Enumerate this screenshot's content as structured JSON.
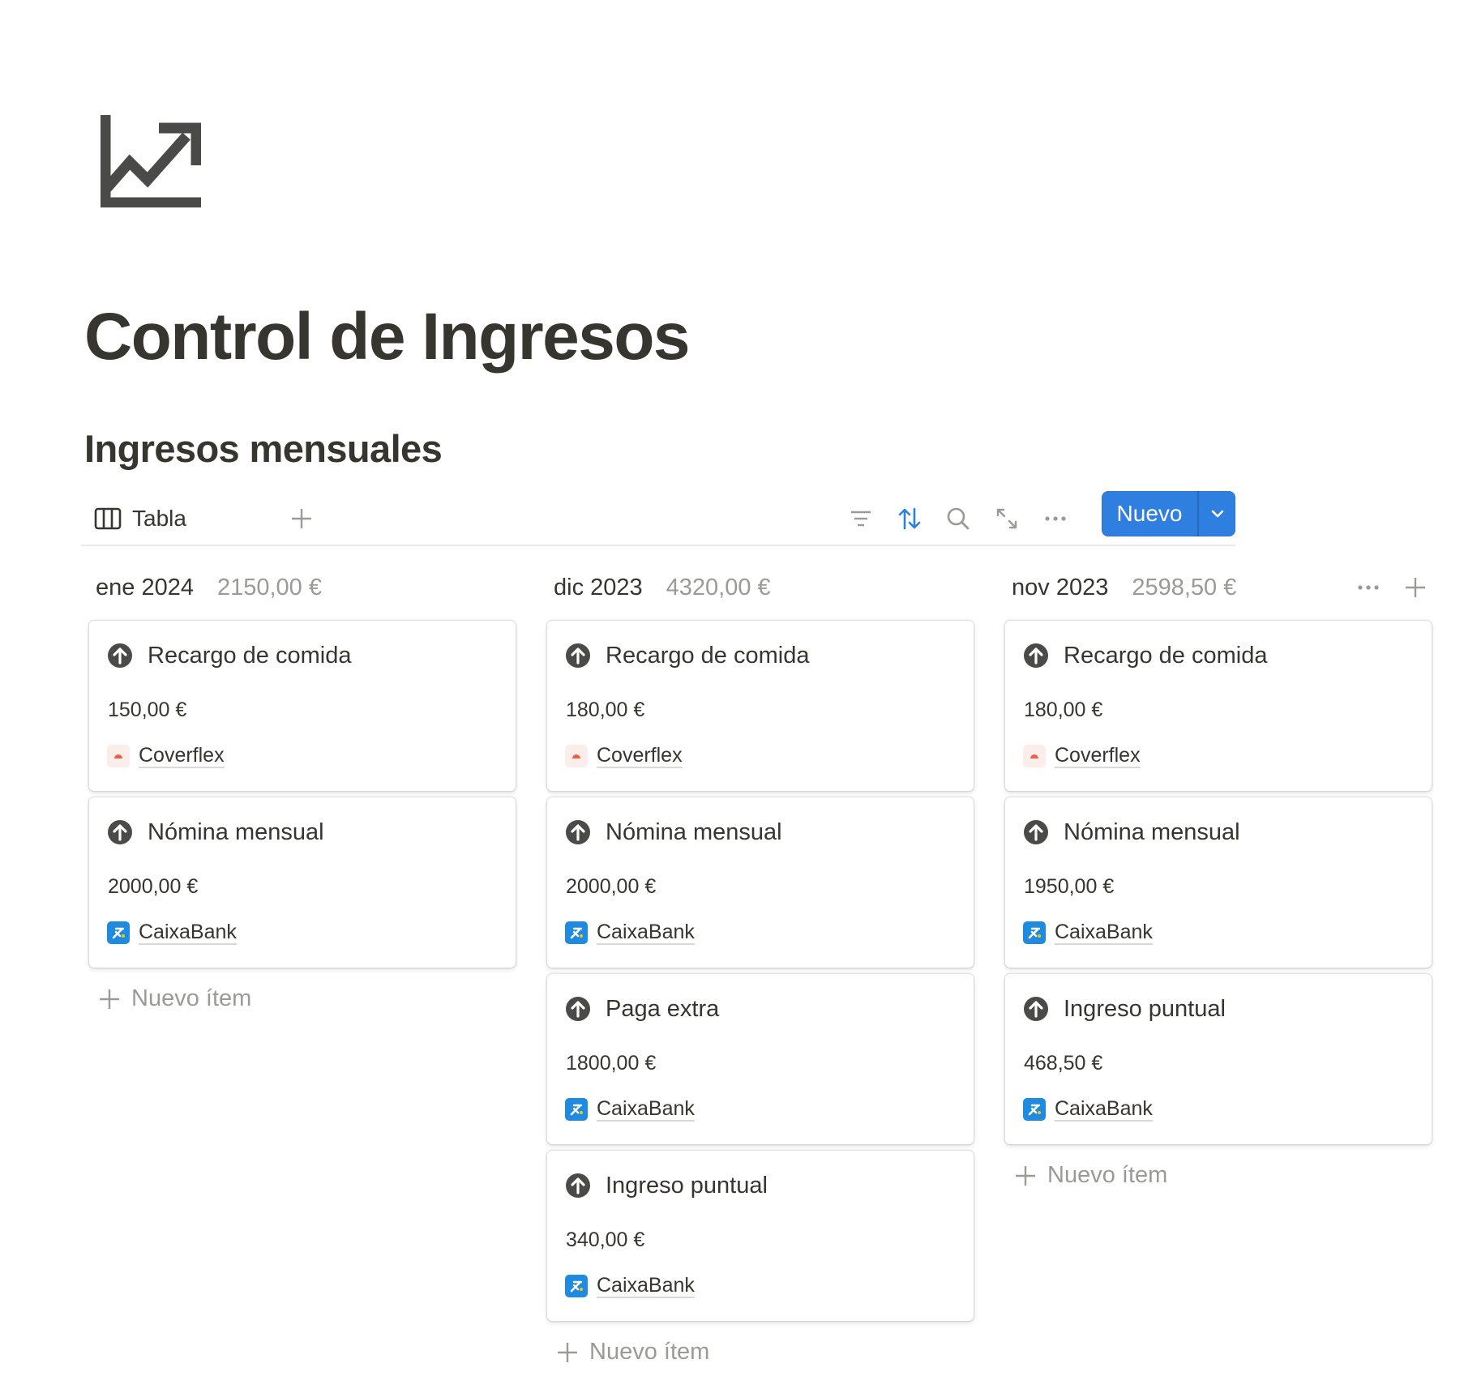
{
  "page": {
    "icon": "trending-up-chart-icon",
    "title": "Control de Ingresos"
  },
  "database": {
    "title": "Ingresos mensuales",
    "view_tab": {
      "label": "Tabla",
      "icon": "board-view-icon"
    },
    "toolbar": {
      "add_view_icon": "plus-icon",
      "filter_icon": "filter-icon",
      "sort_icon": "sort-icon",
      "search_icon": "search-icon",
      "expand_icon": "expand-icon",
      "more_icon": "more-horizontal-icon",
      "new_button_label": "Nuevo",
      "new_button_caret_icon": "chevron-down-icon"
    },
    "accent_color": "#2f7fe0",
    "columns": [
      {
        "title": "ene 2024",
        "sum": "2150,00 €",
        "new_item_label": "Nuevo ítem",
        "cards": [
          {
            "title": "Recargo de comida",
            "amount": "150,00 €",
            "relation": "Coverflex"
          },
          {
            "title": "Nómina mensual",
            "amount": "2000,00 €",
            "relation": "CaixaBank"
          }
        ]
      },
      {
        "title": "dic 2023",
        "sum": "4320,00 €",
        "new_item_label": "Nuevo ítem",
        "cards": [
          {
            "title": "Recargo de comida",
            "amount": "180,00 €",
            "relation": "Coverflex"
          },
          {
            "title": "Nómina mensual",
            "amount": "2000,00 €",
            "relation": "CaixaBank"
          },
          {
            "title": "Paga extra",
            "amount": "1800,00 €",
            "relation": "CaixaBank"
          },
          {
            "title": "Ingreso puntual",
            "amount": "340,00 €",
            "relation": "CaixaBank"
          }
        ]
      },
      {
        "title": "nov 2023",
        "sum": "2598,50 €",
        "new_item_label": "Nuevo ítem",
        "cards": [
          {
            "title": "Recargo de comida",
            "amount": "180,00 €",
            "relation": "Coverflex"
          },
          {
            "title": "Nómina mensual",
            "amount": "1950,00 €",
            "relation": "CaixaBank"
          },
          {
            "title": "Ingreso puntual",
            "amount": "468,50 €",
            "relation": "CaixaBank"
          }
        ]
      }
    ]
  }
}
